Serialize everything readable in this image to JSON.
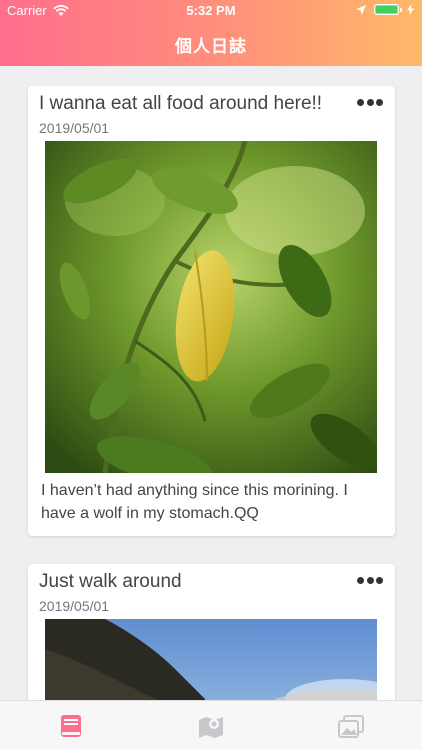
{
  "status_bar": {
    "carrier": "Carrier",
    "time": "5:32 PM"
  },
  "nav": {
    "title": "個人日誌"
  },
  "entries": [
    {
      "title": "I wanna eat all food around here!!",
      "date": "2019/05/01",
      "body": "I haven’t had anything since this morining. I have a wolf in my stomach.QQ",
      "photo_icon": "plant-leaves-photo"
    },
    {
      "title": "Just walk around",
      "date": "2019/05/01",
      "photo_icon": "cliff-sky-photo"
    }
  ],
  "tab_bar": {
    "active_color": "#ff6e8c",
    "inactive_color": "#c7c7cc",
    "tabs": [
      {
        "icon": "journal-book-icon",
        "active": true
      },
      {
        "icon": "map-icon",
        "active": false
      },
      {
        "icon": "photos-icon",
        "active": false
      }
    ]
  },
  "colors": {
    "header_gradient_start": "#ff6e8c",
    "header_gradient_end": "#ffb968",
    "battery": "#43d05b"
  }
}
